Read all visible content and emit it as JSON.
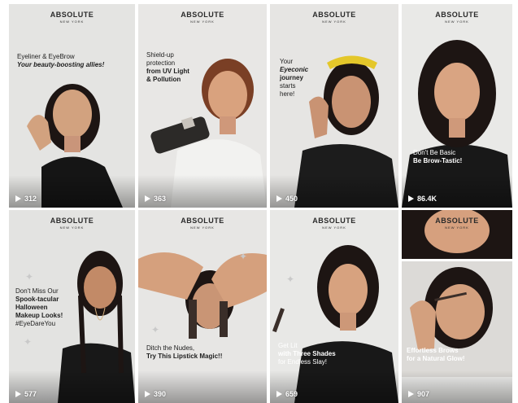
{
  "brand": {
    "name": "ABSOLUTE",
    "sub": "NEW YORK"
  },
  "tiles": [
    {
      "caption": [
        "Eyeliner & EyeBrow",
        "Your beauty-boosting allies!"
      ],
      "views": "312"
    },
    {
      "caption": [
        "Shield-up",
        "protection",
        "from UV Light",
        "& Pollution"
      ],
      "views": "363"
    },
    {
      "caption": [
        "Your",
        "Eyeconic",
        "journey",
        "starts",
        "here!"
      ],
      "views": "450"
    },
    {
      "caption": [
        "Don't Be Basic",
        "Be Brow-Tastic!"
      ],
      "views": "86.4K"
    },
    {
      "caption": [
        "Don't Miss Our",
        "Spook-tacular",
        "Halloween",
        "Makeup Looks!",
        "#EyeDareYou"
      ],
      "views": "577"
    },
    {
      "caption": [
        "Ditch the Nudes,",
        "Try This Lipstick Magic!!"
      ],
      "views": "390"
    },
    {
      "caption": [
        "Get Lit",
        "with Three Shades",
        "for Endless Slay!"
      ],
      "views": "659"
    },
    {
      "caption": [
        "Effortless Brows",
        "for a Natural Glow!"
      ],
      "views": "907"
    }
  ],
  "colors": {
    "skin": "#d8a27e",
    "hair": "#1d1513",
    "bg_light": "#e6e6e4"
  },
  "icons": {
    "play": "play-icon",
    "sparkle": "sparkle-icon"
  }
}
